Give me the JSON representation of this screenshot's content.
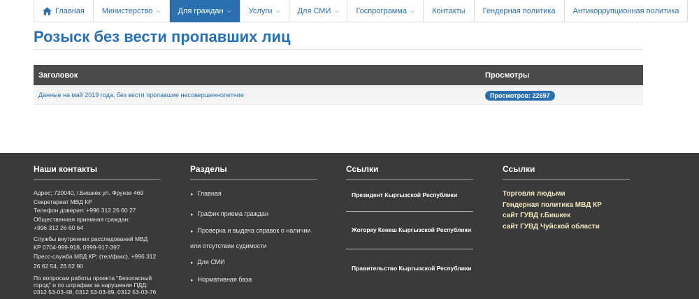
{
  "nav": {
    "items": [
      {
        "label": "Главная",
        "caret": false,
        "active": false
      },
      {
        "label": "Министерство",
        "caret": true,
        "active": false
      },
      {
        "label": "Для граждан",
        "caret": true,
        "active": true
      },
      {
        "label": "Услуги",
        "caret": true,
        "active": false
      },
      {
        "label": "Для СМИ",
        "caret": true,
        "active": false
      },
      {
        "label": "Госпрограмма",
        "caret": true,
        "active": false
      },
      {
        "label": "Контакты",
        "caret": false,
        "active": false
      },
      {
        "label": "Гендерная политика",
        "caret": false,
        "active": false
      },
      {
        "label": "Антикоррупционная политика",
        "caret": false,
        "active": false
      }
    ]
  },
  "page": {
    "title": "Розыск без вести пропавших лиц"
  },
  "table": {
    "col_title": "Заголовок",
    "col_views": "Просмотры",
    "rows": [
      {
        "title": "Данные на май 2019 года, без вести пропавшие несовершеннолетние",
        "views": "Просмотров: 22697"
      }
    ]
  },
  "footer": {
    "contacts": {
      "heading": "Наши контакты",
      "lines": [
        "Адрес; 720040, г.Бишкек ул. Фрунзе 469",
        "Секретариат МВД КР",
        "Телефон доверия: +996 312 26 60 27",
        "Общественная приемная граждан:",
        "+996 312 26 60 64",
        "Службы внутренних расследований МВД",
        "КР 0704-999-918, 0999-917-397",
        "Пресс-служба МВД КР: (тел/факс), +996 312",
        "26 62 54, 26 62 90",
        "По вопросам работы проекта \"Безопасный",
        "город\" и по штрафам за нарушения ПДД:",
        "0312 53-03-48, 0312 53-03-89, 0312 53-03-76"
      ]
    },
    "sections": {
      "heading": "Разделы",
      "items": [
        "Главная",
        "График приема граждан",
        "Проверка и выдача справок о наличии",
        "или отсутствии судимости",
        "Для СМИ",
        "Нормативная база"
      ]
    },
    "links1": {
      "heading": "Ссылки",
      "items": [
        "Президент Кыргызской Республики",
        "Жогорку Кенеш Кыргызской Республики",
        "Правительство Кыргызской Республики"
      ]
    },
    "links2": {
      "heading": "Ссылки",
      "items": [
        "Торговля людьми",
        "Гендерная политика МВД КР",
        "сайт ГУВД г.Бишкек",
        "сайт ГУВД Чуйской области"
      ]
    }
  }
}
